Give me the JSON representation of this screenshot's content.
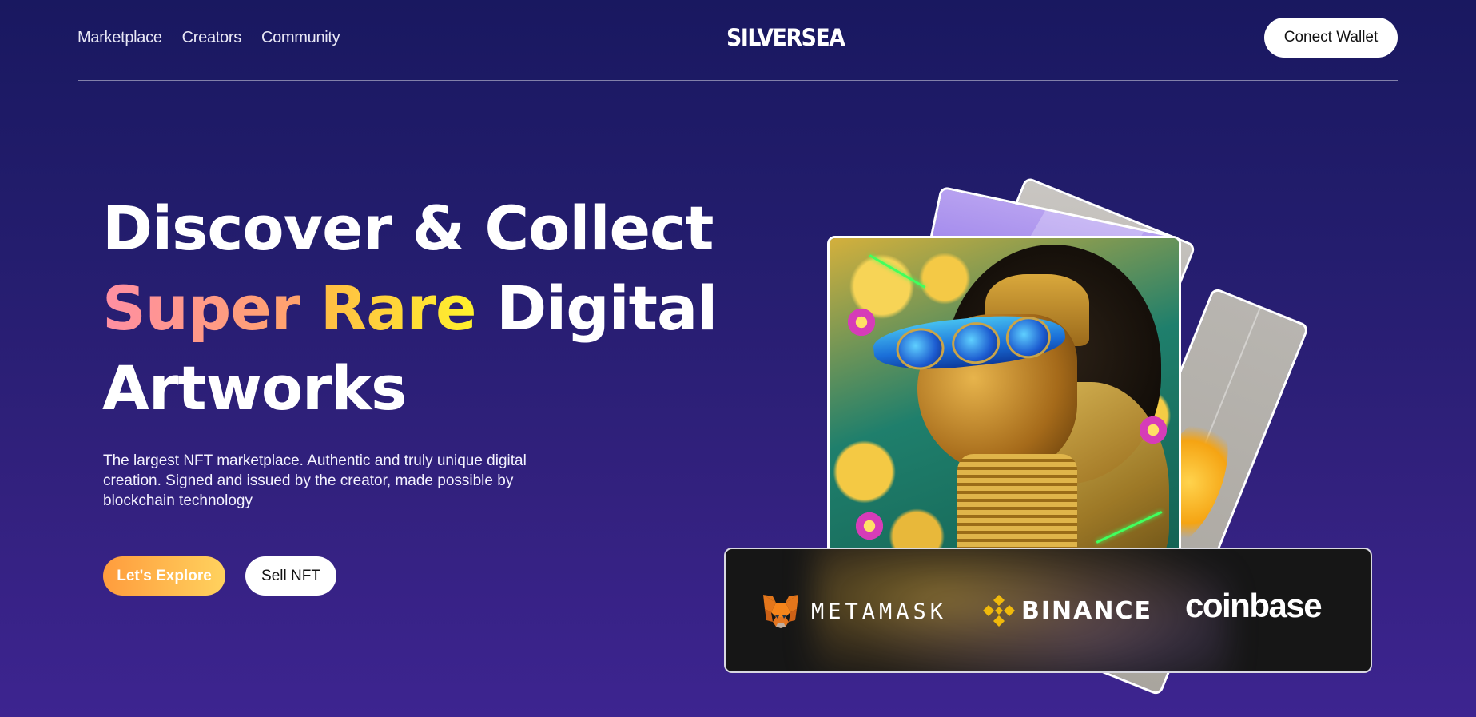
{
  "header": {
    "nav": [
      {
        "label": "Marketplace"
      },
      {
        "label": "Creators"
      },
      {
        "label": "Community"
      }
    ],
    "logo": "SILVERSEA",
    "wallet_button": "Conect Wallet"
  },
  "hero": {
    "title_line1": "Discover & Collect",
    "title_super": "Super",
    "title_rare": "Rare",
    "title_digital": "Digital",
    "title_line3": "Artworks",
    "description": "The largest NFT marketplace. Authentic and truly unique digital creation. Signed and issued by the creator, made possible by blockchain technology",
    "explore_button": "Let's Explore",
    "sell_button": "Sell NFT"
  },
  "partners": [
    {
      "name": "METAMASK",
      "icon": "metamask-fox-icon"
    },
    {
      "name": "BINANCE",
      "icon": "binance-diamond-icon"
    },
    {
      "name": "coinbase",
      "icon": ""
    }
  ],
  "colors": {
    "bg_top": "#191860",
    "bg_bottom": "#3d2490",
    "explore_gradient_start": "#ff9c3d",
    "explore_gradient_end": "#ffd25e",
    "super_gradient": "#ff8fa3",
    "rare_gradient": "#fff22c"
  }
}
